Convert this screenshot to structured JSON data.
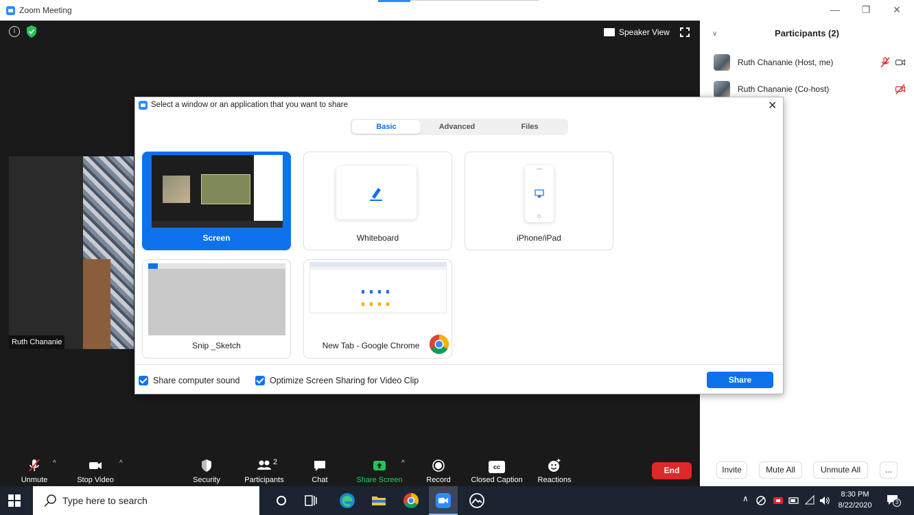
{
  "window": {
    "title": "Zoom Meeting",
    "controls": {
      "minimize": "—",
      "restore": "❐",
      "close": "✕"
    }
  },
  "meeting": {
    "speaker_view_label": "Speaker View",
    "video_tile_name": "Ruth Chananie"
  },
  "toolbar": {
    "unmute": "Unmute",
    "stop_video": "Stop Video",
    "security": "Security",
    "participants": "Participants",
    "participants_count": "2",
    "chat": "Chat",
    "share_screen": "Share Screen",
    "record": "Record",
    "closed_caption": "Closed Caption",
    "cc_badge": "cc",
    "reactions": "Reactions",
    "end": "End"
  },
  "participants_panel": {
    "title": "Participants (2)",
    "participants": [
      {
        "name": "Ruth Chananie (Host, me)"
      },
      {
        "name": "Ruth Chananie (Co-host)"
      }
    ],
    "buttons": {
      "invite": "Invite",
      "mute_all": "Mute All",
      "unmute_all": "Unmute All",
      "more": "..."
    }
  },
  "share_dialog": {
    "title": "Select a window or an application that you want to share",
    "close": "✕",
    "tabs": [
      {
        "label": "Basic",
        "active": true
      },
      {
        "label": "Advanced",
        "active": false
      },
      {
        "label": "Files",
        "active": false
      }
    ],
    "options": [
      {
        "label": "Screen",
        "selected": true
      },
      {
        "label": "Whiteboard",
        "selected": false
      },
      {
        "label": "iPhone/iPad",
        "selected": false
      },
      {
        "label": "Snip _Sketch",
        "selected": false
      },
      {
        "label": "New Tab - Google Chrome",
        "selected": false
      }
    ],
    "checkboxes": [
      {
        "label": "Share computer sound",
        "checked": true
      },
      {
        "label": "Optimize Screen Sharing for Video Clip",
        "checked": true
      }
    ],
    "share_button": "Share"
  },
  "taskbar": {
    "search_placeholder": "Type here to search",
    "time": "8:30 PM",
    "date": "8/22/2020",
    "notification_count": "3"
  },
  "colors": {
    "zoom_blue": "#0e72ed",
    "end_red": "#e02828",
    "share_green": "#1fc65a",
    "dark_bg": "#1a1a1a"
  }
}
